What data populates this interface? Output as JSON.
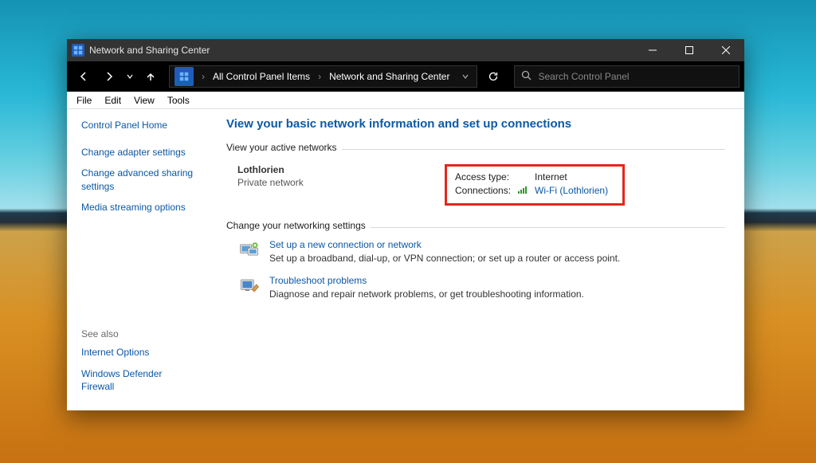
{
  "window": {
    "title": "Network and Sharing Center",
    "breadcrumbs": [
      "All Control Panel Items",
      "Network and Sharing Center"
    ],
    "search_placeholder": "Search Control Panel"
  },
  "menubar": [
    "File",
    "Edit",
    "View",
    "Tools"
  ],
  "sidebar": {
    "home": "Control Panel Home",
    "links": [
      "Change adapter settings",
      "Change advanced sharing settings",
      "Media streaming options"
    ],
    "see_also_label": "See also",
    "see_also": [
      "Internet Options",
      "Windows Defender Firewall"
    ]
  },
  "content": {
    "page_title": "View your basic network information and set up connections",
    "active_group_label": "View your active networks",
    "active_network": {
      "name": "Lothlorien",
      "profile": "Private network",
      "access_type_label": "Access type:",
      "access_type_value": "Internet",
      "connections_label": "Connections:",
      "connection_link": "Wi-Fi (Lothlorien)"
    },
    "settings_group_label": "Change your networking settings",
    "tasks": [
      {
        "link": "Set up a new connection or network",
        "desc": "Set up a broadband, dial-up, or VPN connection; or set up a router or access point."
      },
      {
        "link": "Troubleshoot problems",
        "desc": "Diagnose and repair network problems, or get troubleshooting information."
      }
    ]
  }
}
